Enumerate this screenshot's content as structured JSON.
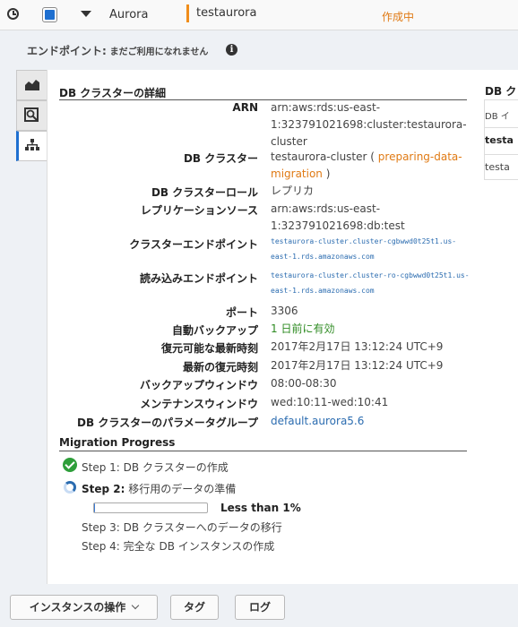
{
  "row": {
    "name": "Aurora",
    "identifier": "testaurora",
    "status": "作成中"
  },
  "endpoint": {
    "label": "エンドポイント:",
    "status": "まだご利用になれません",
    "info_icon": "i"
  },
  "tabs": [
    {
      "name": "monitoring",
      "icon": "area-chart-icon"
    },
    {
      "name": "details",
      "icon": "magnify-icon"
    },
    {
      "name": "cluster",
      "icon": "hierarchy-icon",
      "active": true
    }
  ],
  "details": {
    "heading": "DB クラスターの詳細",
    "arn_label": "ARN",
    "arn_value": "arn:aws:rds:us-east-1:323791021698:cluster:testaurora-cluster",
    "cluster_label": "DB クラスター",
    "cluster_name": "testaurora-cluster",
    "cluster_open": "( ",
    "cluster_status": "preparing-data-migration",
    "cluster_close": " )",
    "role_label": "DB クラスターロール",
    "role_value": "レプリカ",
    "repl_label": "レプリケーションソース",
    "repl_value": "arn:aws:rds:us-east-1:323791021698:db:test",
    "cluster_ep_label": "クラスターエンドポイント",
    "cluster_ep_value": "testaurora-cluster.cluster-cgbwwd0t25t1.us-east-1.rds.amazonaws.com",
    "reader_ep_label": "読み込みエンドポイント",
    "reader_ep_value": "testaurora-cluster.cluster-ro-cgbwwd0t25t1.us-east-1.rds.amazonaws.com",
    "port_label": "ポート",
    "port_value": "3306",
    "backup_label": "自動バックアップ",
    "backup_value": "1 日前に有効",
    "restorable_label": "復元可能な最新時刻",
    "restorable_value": "2017年2月17日 13:12:24 UTC+9",
    "latest_label": "最新の復元時刻",
    "latest_value": "2017年2月17日 13:12:24 UTC+9",
    "backup_window_label": "バックアップウィンドウ",
    "backup_window_value": "08:00-08:30",
    "maint_label": "メンテナンスウィンドウ",
    "maint_value": "wed:10:11-wed:10:41",
    "param_label": "DB クラスターのパラメータグループ",
    "param_value": "default.aurora5.6"
  },
  "migration": {
    "heading": "Migration Progress",
    "steps": [
      {
        "num": "Step 1:",
        "text": "DB クラスターの作成",
        "state": "done"
      },
      {
        "num": "Step 2:",
        "text": "移行用のデータの準備",
        "state": "in-progress"
      },
      {
        "num": "Step 3:",
        "text": "DB クラスターへのデータの移行",
        "state": "pending"
      },
      {
        "num": "Step 4:",
        "text": "完全な DB インスタンスの作成",
        "state": "pending"
      }
    ],
    "progress_fraction": 0.005,
    "progress_label": "Less than 1%"
  },
  "side": {
    "title": "DB ク",
    "header": "DB イ",
    "row1": "testa",
    "row2": "testa"
  },
  "buttons": {
    "instance_actions": "インスタンスの操作",
    "tags": "タグ",
    "logs": "ログ"
  },
  "colors": {
    "accent_blue": "#1e6fd0",
    "status_orange": "#e07a14",
    "success_green": "#2e8b22",
    "link_blue": "#2b6cb0"
  }
}
